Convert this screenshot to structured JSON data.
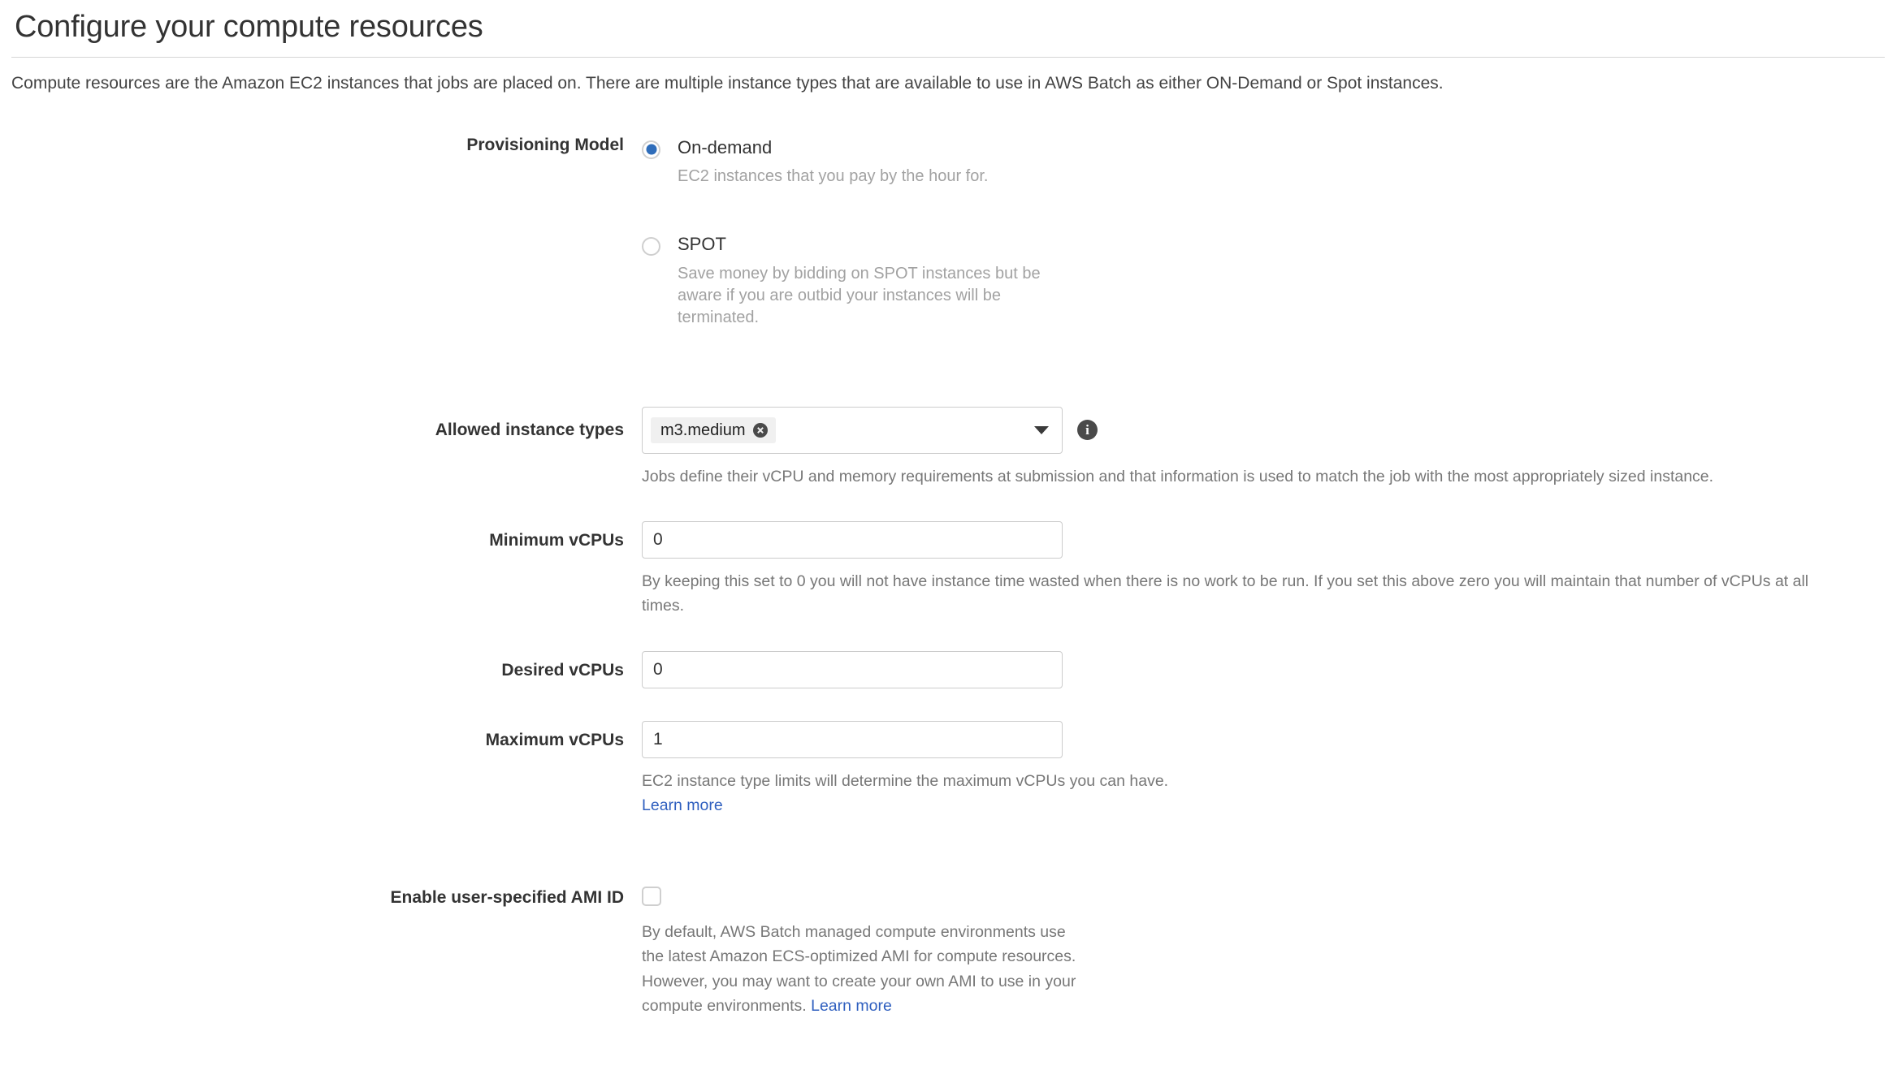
{
  "header": {
    "title": "Configure your compute resources",
    "subtitle": "Compute resources are the Amazon EC2 instances that jobs are placed on. There are multiple instance types that are available to use in AWS Batch as either ON-Demand or Spot instances."
  },
  "colors": {
    "radio_selected": "#2f6dba",
    "link": "#2f5fbf",
    "label_text": "#333333",
    "help_text": "#777777",
    "muted_text": "#a2a2a2",
    "border": "#cccccc",
    "tag_background": "#f0f0f0",
    "icon_dark": "#4a4a4a"
  },
  "provisioning_model": {
    "label": "Provisioning Model",
    "selected": "on-demand",
    "options": [
      {
        "id": "on-demand",
        "label": "On-demand",
        "description": "EC2 instances that you pay by the hour for.",
        "checked": true
      },
      {
        "id": "spot",
        "label": "SPOT",
        "description": "Save money by bidding on SPOT instances but be aware if you are outbid your instances will be terminated.",
        "checked": false
      }
    ]
  },
  "allowed_instance_types": {
    "label": "Allowed instance types",
    "tags": [
      {
        "value": "m3.medium",
        "remove_title": "Remove m3.medium"
      }
    ],
    "placeholder": "",
    "help": "Jobs define their vCPU and memory requirements at submission and that information is used to match the job with the most appropriately sized instance.",
    "info_icon": "info-icon",
    "caret_icon": "chevron-down-icon"
  },
  "minimum_vcpus": {
    "label": "Minimum vCPUs",
    "value": "0",
    "placeholder": "",
    "help": "By keeping this set to 0 you will not have instance time wasted when there is no work to be run. If you set this above zero you will maintain that number of vCPUs at all times."
  },
  "desired_vcpus": {
    "label": "Desired vCPUs",
    "value": "0",
    "placeholder": ""
  },
  "maximum_vcpus": {
    "label": "Maximum vCPUs",
    "value": "1",
    "placeholder": "",
    "help": "EC2 instance type limits will determine the maximum vCPUs you can have.",
    "learn_more": "Learn more"
  },
  "enable_ami": {
    "label": "Enable user-specified AMI ID",
    "checked": false,
    "help_before": "By default, AWS Batch managed compute environments use the latest Amazon ECS-optimized AMI for compute resources. However, you may want to create your own AMI to use in your compute environments. ",
    "learn_more": "Learn more"
  }
}
